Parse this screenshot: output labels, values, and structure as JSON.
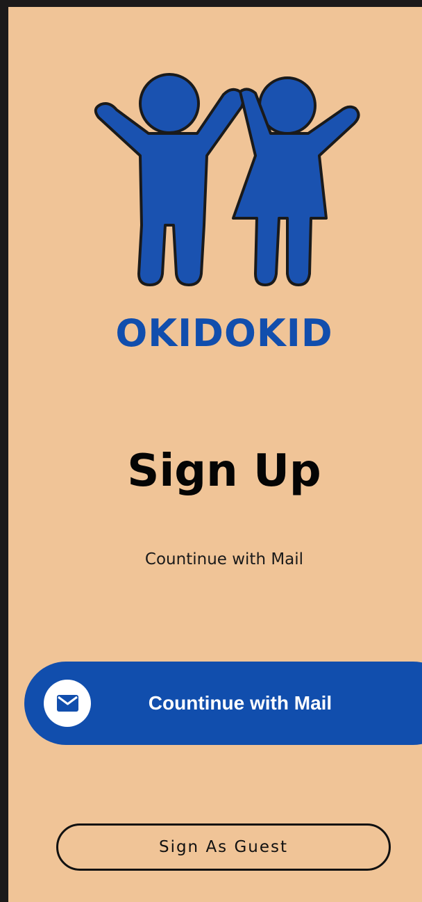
{
  "brand": {
    "name": "OKIDOKID",
    "color": "#114ead",
    "logo_icon": "two-kids-holding-hands-icon"
  },
  "screen": {
    "background": "#f0c497",
    "title": "Sign Up",
    "subtitle": "Countinue with Mail"
  },
  "actions": {
    "mail_button_label": "Countinue with Mail",
    "mail_button_icon": "mail-icon",
    "guest_button_label": "Sign As Guest"
  }
}
